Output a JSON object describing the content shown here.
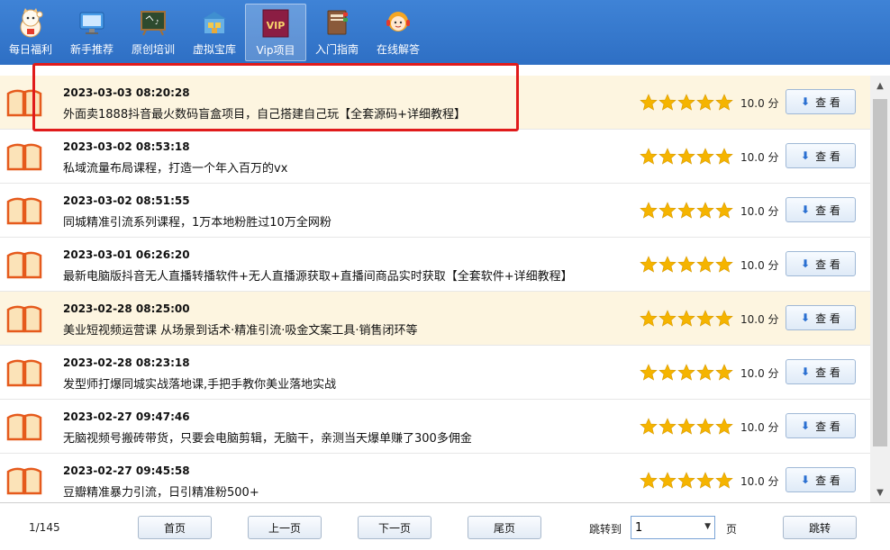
{
  "toolbar": {
    "items": [
      {
        "label": "每日福利",
        "icon": "lucky-cat-icon"
      },
      {
        "label": "新手推荐",
        "icon": "monitor-icon"
      },
      {
        "label": "原创培训",
        "icon": "blackboard-icon"
      },
      {
        "label": "虚拟宝库",
        "icon": "warehouse-icon"
      },
      {
        "label": "Vip项目",
        "icon": "vip-icon",
        "badge": "VIP",
        "active": true
      },
      {
        "label": "入门指南",
        "icon": "book-guide-icon"
      },
      {
        "label": "在线解答",
        "icon": "support-agent-icon"
      }
    ]
  },
  "list": {
    "rows": [
      {
        "date": "2023-03-03 08:20:28",
        "title": "外面卖1888抖音最火数码盲盒项目，自己搭建自己玩【全套源码+详细教程】",
        "rating": 5,
        "score": "10.0 分",
        "button": "查 看",
        "highlight": true
      },
      {
        "date": "2023-03-02 08:53:18",
        "title": "私域流量布局课程，打造一个年入百万的vx",
        "rating": 5,
        "score": "10.0 分",
        "button": "查 看",
        "highlight": false
      },
      {
        "date": "2023-03-02 08:51:55",
        "title": "同城精准引流系列课程，1万本地粉胜过10万全网粉",
        "rating": 5,
        "score": "10.0 分",
        "button": "查 看",
        "highlight": false
      },
      {
        "date": "2023-03-01 06:26:20",
        "title": "最新电脑版抖音无人直播转播软件+无人直播源获取+直播间商品实时获取【全套软件+详细教程】",
        "rating": 5,
        "score": "10.0 分",
        "button": "查 看",
        "highlight": false
      },
      {
        "date": "2023-02-28 08:25:00",
        "title": "美业短视频运营课 从场景到话术·精准引流·吸金文案工具·销售闭环等",
        "rating": 5,
        "score": "10.0 分",
        "button": "查 看",
        "highlight": true
      },
      {
        "date": "2023-02-28 08:23:18",
        "title": "发型师打爆同城实战落地课,手把手教你美业落地实战",
        "rating": 5,
        "score": "10.0 分",
        "button": "查 看",
        "highlight": false
      },
      {
        "date": "2023-02-27 09:47:46",
        "title": "无脑视频号搬砖带货，只要会电脑剪辑，无脑干，亲测当天爆单赚了300多佣金",
        "rating": 5,
        "score": "10.0 分",
        "button": "查 看",
        "highlight": false
      },
      {
        "date": "2023-02-27 09:45:58",
        "title": "豆瓣精准暴力引流，日引精准粉500+",
        "rating": 5,
        "score": "10.0 分",
        "button": "查 看",
        "highlight": false
      }
    ]
  },
  "footer": {
    "page_info": "1/145",
    "first": "首页",
    "prev": "上一页",
    "next": "下一页",
    "last": "尾页",
    "jump_label": "跳转到",
    "jump_value": "1",
    "page_unit": "页",
    "go": "跳转"
  },
  "colors": {
    "toolbar": "#3a7ed3",
    "highlight_row": "#fdf5e0",
    "star": "#f5b400",
    "annotation_box": "#e01b1b"
  }
}
